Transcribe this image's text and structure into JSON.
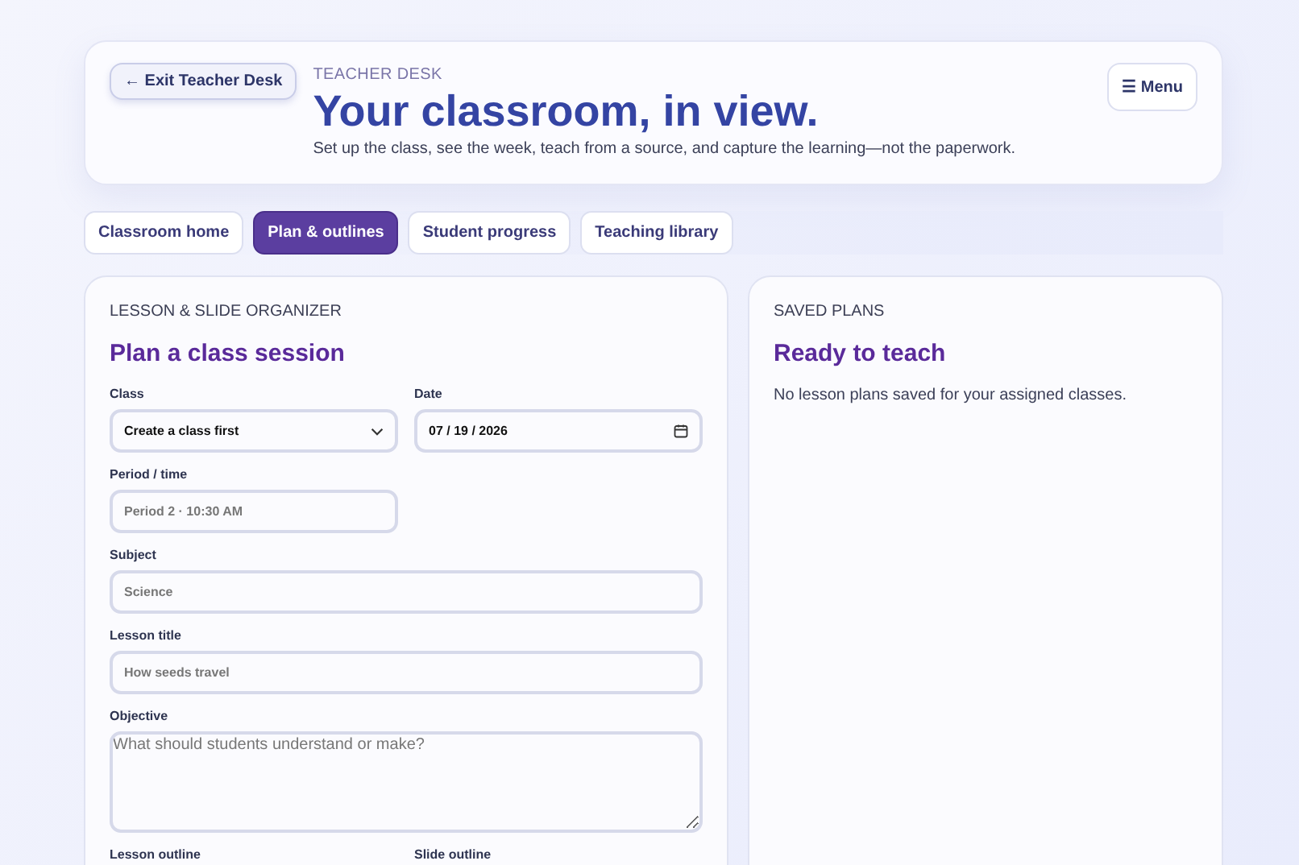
{
  "header": {
    "back_button": "← Exit Teacher Desk",
    "eyebrow": "TEACHER DESK",
    "title": "Your classroom, in view.",
    "subtitle": "Set up the class, see the week, teach from a source, and capture the learning—not the paperwork.",
    "menu_button": "☰ Menu"
  },
  "tabs": [
    {
      "label": "Classroom home",
      "selected": false
    },
    {
      "label": "Plan & outlines",
      "selected": true
    },
    {
      "label": "Student progress",
      "selected": false
    },
    {
      "label": "Teaching library",
      "selected": false
    }
  ],
  "organizer": {
    "eyebrow": "LESSON & SLIDE ORGANIZER",
    "title": "Plan a class session",
    "fields": [
      {
        "kind": "select",
        "label": "Class",
        "value": "Create a class first"
      },
      {
        "kind": "date",
        "label": "Date",
        "value": "07 / 19 / 2026"
      },
      {
        "kind": "short_text",
        "label": "Period / time",
        "placeholder": "Period 2 · 10:30 AM"
      },
      {
        "kind": "text",
        "label": "Subject",
        "placeholder": "Science"
      },
      {
        "kind": "text",
        "label": "Lesson title",
        "placeholder": "How seeds travel"
      },
      {
        "kind": "textarea",
        "label": "Objective",
        "placeholder": "What should students understand or make?"
      },
      {
        "kind": "label",
        "label": "Lesson outline"
      },
      {
        "kind": "label",
        "label": "Slide outline"
      }
    ]
  },
  "saved_plans": {
    "eyebrow": "SAVED PLANS",
    "title": "Ready to teach",
    "message": "No lesson plans saved for your assigned classes."
  }
}
